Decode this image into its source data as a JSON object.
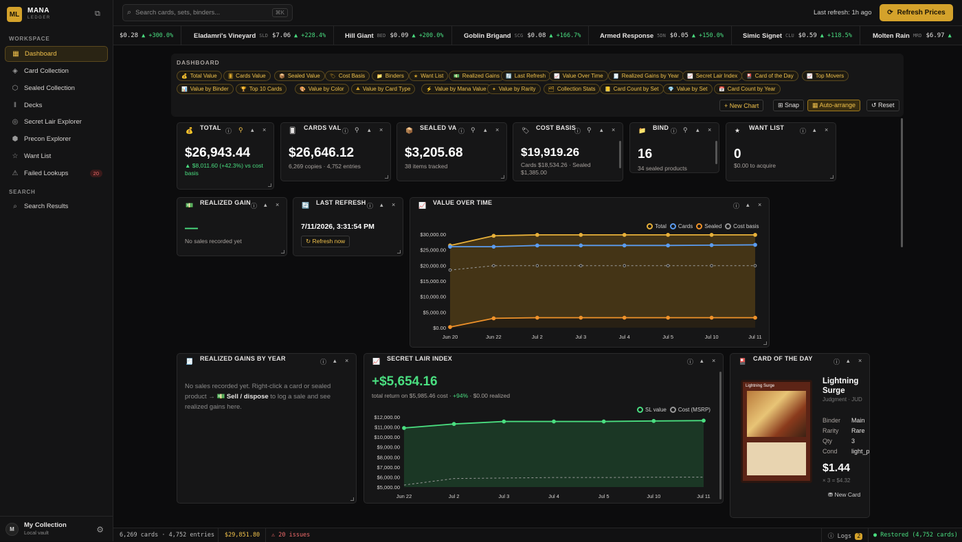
{
  "app": {
    "initials": "ML",
    "name": "MANA",
    "sub": "LEDGER"
  },
  "sidebar": {
    "workspace_label": "WORKSPACE",
    "items": [
      {
        "label": "Dashboard",
        "icon": "dashboard-icon"
      },
      {
        "label": "Card Collection",
        "icon": "layers-icon"
      },
      {
        "label": "Sealed Collection",
        "icon": "box-icon"
      },
      {
        "label": "Decks",
        "icon": "books-icon"
      },
      {
        "label": "Secret Lair Explorer",
        "icon": "compass-icon"
      },
      {
        "label": "Precon Explorer",
        "icon": "package-icon"
      },
      {
        "label": "Want List",
        "icon": "star-icon"
      },
      {
        "label": "Failed Lookups",
        "icon": "warning-icon",
        "badge": "20"
      }
    ],
    "search_label": "SEARCH",
    "search_items": [
      {
        "label": "Search Results",
        "icon": "search-icon"
      }
    ],
    "user": {
      "initial": "M",
      "name": "My Collection",
      "sub": "Local vault"
    }
  },
  "topbar": {
    "search_placeholder": "Search cards, sets, binders...",
    "shortcut": "⌘K",
    "last_refresh": "Last refresh: 1h ago",
    "refresh_button": "Refresh Prices"
  },
  "ticker": [
    {
      "name": "",
      "set": "",
      "price": "$0.28",
      "change": "▲ +300.0%"
    },
    {
      "name": "Eladamri's Vineyard",
      "set": "SLD",
      "price": "$7.06",
      "change": "▲ +228.4%"
    },
    {
      "name": "Hill Giant",
      "set": "BED",
      "price": "$0.09",
      "change": "▲ +200.0%"
    },
    {
      "name": "Goblin Brigand",
      "set": "SCG",
      "price": "$0.08",
      "change": "▲ +166.7%"
    },
    {
      "name": "Armed Response",
      "set": "5DN",
      "price": "$0.05",
      "change": "▲ +150.0%"
    },
    {
      "name": "Simic Signet",
      "set": "CLU",
      "price": "$0.59",
      "change": "▲ +118.5%"
    },
    {
      "name": "Molten Rain",
      "set": "MRD",
      "price": "$6.97",
      "change": "▲"
    }
  ],
  "dashboard": {
    "title": "DASHBOARD",
    "chips": [
      "Total Value",
      "Cards Value",
      "Sealed Value",
      "Cost Basis",
      "Binders",
      "Want List",
      "Realized Gains",
      "Last Refresh",
      "Value Over Time",
      "Realized Gains by Year",
      "Secret Lair Index",
      "Card of the Day",
      "Top Movers",
      "Value by Binder",
      "Top 10 Cards",
      "Value by Color",
      "Value by Card Type",
      "Value by Mana Value",
      "Value by Rarity",
      "Collection Stats",
      "Card Count by Set",
      "Value by Set",
      "Card Count by Year"
    ],
    "buttons": {
      "new_chart": "+ New Chart",
      "snap": "⊞ Snap",
      "auto": "▦ Auto-arrange",
      "reset": "↺ Reset"
    }
  },
  "widgets": {
    "total": {
      "title": "TOTAL",
      "value": "$26,943.44",
      "sub": "▲ $8,011.60 (+42.3%) vs cost basis"
    },
    "cards": {
      "title": "CARDS VAL",
      "value": "$26,646.12",
      "sub": "6,269 copies · 4,752 entries"
    },
    "sealed": {
      "title": "SEALED VA",
      "value": "$3,205.68",
      "sub": "38 items tracked"
    },
    "cost": {
      "title": "COST BASIS",
      "value": "$19,919.26",
      "sub": "Cards $18,534.26 · Sealed $1,385.00"
    },
    "binders": {
      "title": "BIND",
      "value": "16",
      "sub": "34 sealed products"
    },
    "want": {
      "title": "WANT LIST",
      "value": "0",
      "sub": "$0.00 to acquire"
    },
    "realized": {
      "title": "REALIZED GAIN",
      "value": "—",
      "sub": "No sales recorded yet"
    },
    "last_refresh": {
      "title": "LAST REFRESH",
      "value": "7/11/2026, 3:31:54 PM",
      "button": "↻ Refresh now"
    },
    "value_over_time": {
      "title": "VALUE OVER TIME"
    },
    "gains_by_year": {
      "title": "REALIZED GAINS BY YEAR",
      "text1": "No sales recorded yet. Right-click a card or sealed product →",
      "action": "💵 Sell / dispose",
      "text2": "to log a sale and see realized gains here."
    },
    "secret_lair": {
      "title": "SECRET LAIR INDEX",
      "value": "+$5,654.16",
      "sub_a": "total return on $5,985.46 cost ·",
      "sub_b": "+94%",
      "sub_c": "· $0.00 realized"
    },
    "cotd": {
      "title": "CARD OF THE DAY",
      "card_label": "Lightning Surge",
      "name": "Lightning Surge",
      "set": "Judgment · JUD",
      "fields": [
        {
          "k": "Binder",
          "v": "Main"
        },
        {
          "k": "Rarity",
          "v": "Rare"
        },
        {
          "k": "Qty",
          "v": "3"
        },
        {
          "k": "Cond",
          "v": "light_played"
        }
      ],
      "price": "$1.44",
      "calc": "× 3 = $4.32",
      "new_card": "New Card"
    }
  },
  "chart_data": [
    {
      "type": "line",
      "x": [
        "Jun 20",
        "Jun 22",
        "Jul 2",
        "Jul 3",
        "Jul 4",
        "Jul 5",
        "Jul 10",
        "Jul 11"
      ],
      "ylim": [
        0,
        30000
      ],
      "yticks": [
        "$0.00",
        "$5,000.00",
        "$10,000.00",
        "$15,000.00",
        "$20,000.00",
        "$25,000.00",
        "$30,000.00"
      ],
      "series": [
        {
          "name": "Total",
          "color": "#e8b13a",
          "values": [
            26400,
            29500,
            29800,
            29800,
            29800,
            29800,
            29800,
            29800
          ]
        },
        {
          "name": "Cards",
          "color": "#5b9cf0",
          "values": [
            26000,
            26000,
            26400,
            26400,
            26400,
            26400,
            26500,
            26600
          ]
        },
        {
          "name": "Sealed",
          "color": "#f0922a",
          "values": [
            200,
            3000,
            3200,
            3200,
            3200,
            3200,
            3200,
            3200
          ]
        },
        {
          "name": "Cost basis",
          "color": "#9a9a9a",
          "values": [
            18500,
            19900,
            19900,
            19900,
            19900,
            19900,
            19900,
            19900
          ]
        }
      ],
      "legend": "top-right"
    },
    {
      "type": "line",
      "x": [
        "Jun 22",
        "Jul 2",
        "Jul 3",
        "Jul 4",
        "Jul 5",
        "Jul 10",
        "Jul 11"
      ],
      "ylim": [
        5000,
        12000
      ],
      "yticks": [
        "$5,000.00",
        "$6,000.00",
        "$7,000.00",
        "$8,000.00",
        "$9,000.00",
        "$10,000.00",
        "$11,000.00",
        "$12,000.00"
      ],
      "series": [
        {
          "name": "SL value",
          "color": "#4ade80",
          "values": [
            10900,
            11300,
            11550,
            11550,
            11550,
            11600,
            11640
          ]
        },
        {
          "name": "Cost (MSRP)",
          "color": "#9a9a9a",
          "values": [
            5200,
            5850,
            5900,
            5950,
            5950,
            5980,
            5985
          ]
        }
      ],
      "legend": "top-right"
    }
  ],
  "footer": {
    "counts": "6,269 cards · 4,752 entries",
    "value": "$29,851.80",
    "issues": "⚠ 20 issues",
    "logs": "ⓘ Logs",
    "logs_badge": "2",
    "status": "● Restored (4,752 cards)"
  }
}
